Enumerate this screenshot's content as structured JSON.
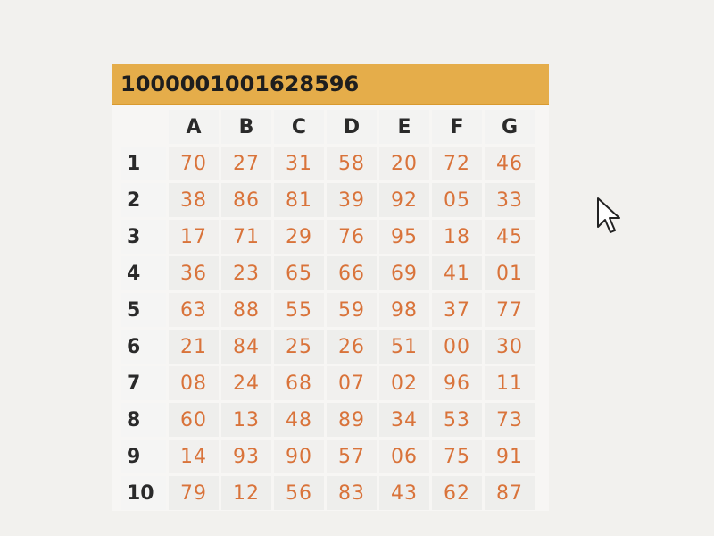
{
  "card": {
    "id": "1000001001628596"
  },
  "grid": {
    "columns": [
      "A",
      "B",
      "C",
      "D",
      "E",
      "F",
      "G"
    ],
    "rows": [
      {
        "label": "1",
        "values": [
          "70",
          "27",
          "31",
          "58",
          "20",
          "72",
          "46"
        ]
      },
      {
        "label": "2",
        "values": [
          "38",
          "86",
          "81",
          "39",
          "92",
          "05",
          "33"
        ]
      },
      {
        "label": "3",
        "values": [
          "17",
          "71",
          "29",
          "76",
          "95",
          "18",
          "45"
        ]
      },
      {
        "label": "4",
        "values": [
          "36",
          "23",
          "65",
          "66",
          "69",
          "41",
          "01"
        ]
      },
      {
        "label": "5",
        "values": [
          "63",
          "88",
          "55",
          "59",
          "98",
          "37",
          "77"
        ]
      },
      {
        "label": "6",
        "values": [
          "21",
          "84",
          "25",
          "26",
          "51",
          "00",
          "30"
        ]
      },
      {
        "label": "7",
        "values": [
          "08",
          "24",
          "68",
          "07",
          "02",
          "96",
          "11"
        ]
      },
      {
        "label": "8",
        "values": [
          "60",
          "13",
          "48",
          "89",
          "34",
          "53",
          "73"
        ]
      },
      {
        "label": "9",
        "values": [
          "14",
          "93",
          "90",
          "57",
          "06",
          "75",
          "91"
        ]
      },
      {
        "label": "10",
        "values": [
          "79",
          "12",
          "56",
          "83",
          "43",
          "62",
          "87"
        ]
      }
    ]
  },
  "colors": {
    "header_bg": "#e5ad4a",
    "cell_text": "#d9733a",
    "label_text": "#2a2a2a"
  },
  "icons": {
    "cursor": "mouse-pointer-icon"
  }
}
